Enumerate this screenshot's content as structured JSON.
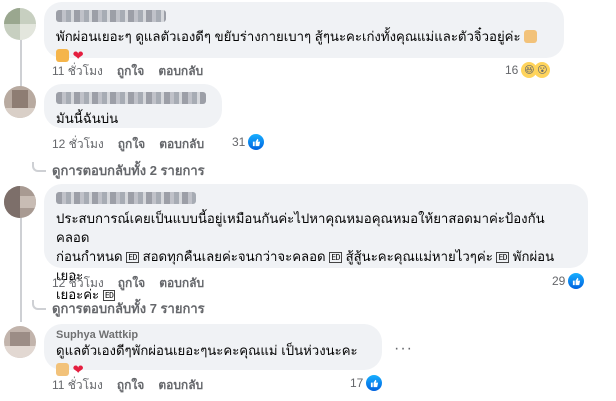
{
  "comments": [
    {
      "text": "พักผ่อนเยอะๆ ดูแลตัวเองดีๆ ขยับร่างกายเบาๆ สู้ๆนะคะเก่งทั้งคุณแม่และตัวจิ๋วอยู่ค่ะ",
      "time": "11 ชั่วโมง",
      "like": "ถูกใจ",
      "reply": "ตอบกลับ",
      "reaction_count": "16"
    },
    {
      "text": "มันนี้ฉันบ่น",
      "time": "12 ชั่วโมง",
      "like": "ถูกใจ",
      "reply": "ตอบกลับ",
      "reaction_count": "31",
      "replies_label": "ดูการตอบกลับทั้ง 2 รายการ"
    },
    {
      "text_line1": "ประสบการณ์เคยเป็นแบบนี้อยู่เหมือนกันค่ะไปหาคุณหมอคุณหมอให้ยาสอดมาค่ะป้องกันคลอด",
      "text_line2a": "ก่อนกำหนด",
      "text_line2b": "สอดทุกคืนเลยค่ะจนกว่าจะคลอด",
      "text_line2c": "สู้สู้นะคะคุณแม่หายไวๆค่ะ",
      "text_line2d": "พักผ่อนเยอะ",
      "text_line3": "เยอะค่ะ",
      "glyph": "ED",
      "time": "12 ชั่วโมง",
      "like": "ถูกใจ",
      "reply": "ตอบกลับ",
      "reaction_count": "29",
      "replies_label": "ดูการตอบกลับทั้ง 7 รายการ"
    },
    {
      "author": "Suphya Wattkip",
      "text": "ดูแลตัวเองดีๆพักผ่อนเยอะๆนะคะคุณแม่ เป็นห่วงนะคะ",
      "time": "11 ชั่วโมง",
      "like": "ถูกใจ",
      "reply": "ตอบกลับ",
      "reaction_count": "17",
      "more": "···"
    }
  ],
  "colors": {
    "like_blue": "#0866ff",
    "heart_red": "#e41e3f",
    "bubble_bg": "#f0f2f5",
    "meta_gray": "#65676b"
  }
}
